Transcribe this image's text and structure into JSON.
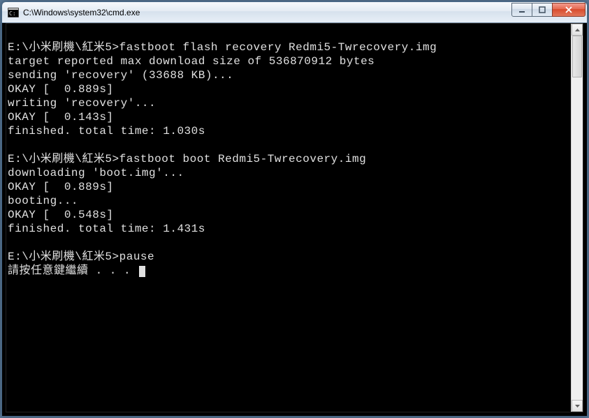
{
  "window": {
    "title": "C:\\Windows\\system32\\cmd.exe"
  },
  "terminal": {
    "lines": [
      "",
      "E:\\小米刷機\\紅米5>fastboot flash recovery Redmi5-Twrecovery.img",
      "target reported max download size of 536870912 bytes",
      "sending 'recovery' (33688 KB)...",
      "OKAY [  0.889s]",
      "writing 'recovery'...",
      "OKAY [  0.143s]",
      "finished. total time: 1.030s",
      "",
      "E:\\小米刷機\\紅米5>fastboot boot Redmi5-Twrecovery.img",
      "downloading 'boot.img'...",
      "OKAY [  0.889s]",
      "booting...",
      "OKAY [  0.548s]",
      "finished. total time: 1.431s",
      "",
      "E:\\小米刷機\\紅米5>pause",
      "請按任意鍵繼續 . . . "
    ]
  },
  "controls": {
    "minimize": "minimize",
    "maximize": "maximize",
    "close": "close"
  }
}
